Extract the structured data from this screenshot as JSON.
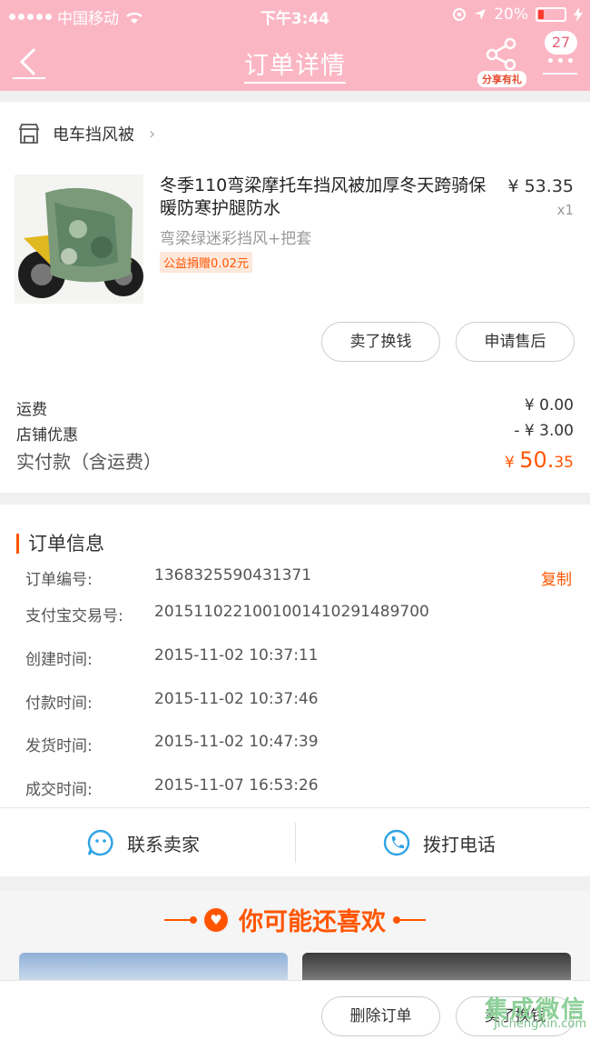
{
  "status_bar": {
    "carrier": "中国移动",
    "time": "下午3:44",
    "battery": "20%"
  },
  "nav": {
    "title": "订单详情",
    "share_tag": "分享有礼",
    "badge_count": "27"
  },
  "shop": {
    "name": "电车挡风被"
  },
  "product": {
    "title": "冬季110弯梁摩托车挡风被加厚冬天跨骑保暖防寒护腿防水",
    "price": "¥ 53.35",
    "qty": "x1",
    "sku": "弯梁绿迷彩挡风+把套",
    "charity_tag": "公益捐赠0.02元",
    "btn_sell": "卖了换钱",
    "btn_aftersale": "申请售后"
  },
  "fees": {
    "shipping_label": "运费",
    "shipping_value": "¥ 0.00",
    "discount_label": "店铺优惠",
    "discount_value": "- ¥ 3.00",
    "total_label": "实付款（含运费）",
    "total_currency": "¥ ",
    "total_int": "50.",
    "total_dec": "35"
  },
  "order_info": {
    "title": "订单信息",
    "copy_label": "复制",
    "rows": [
      {
        "key": "订单编号:",
        "value": "1368325590431371"
      },
      {
        "key": "支付宝交易号:",
        "value": "2015110221001001410291489700"
      },
      {
        "key": "创建时间:",
        "value": "2015-11-02 10:37:11"
      },
      {
        "key": "付款时间:",
        "value": "2015-11-02 10:37:46"
      },
      {
        "key": "发货时间:",
        "value": "2015-11-02 10:47:39"
      },
      {
        "key": "成交时间:",
        "value": "2015-11-07 16:53:26"
      }
    ]
  },
  "contact": {
    "seller": "联系卖家",
    "phone": "拨打电话"
  },
  "recommend": {
    "title": "你可能还喜欢"
  },
  "bottom": {
    "delete": "删除订单",
    "sell": "卖了换钱"
  },
  "watermark": {
    "big": "集成微信",
    "url": "JiChengXin.com"
  },
  "colors": {
    "header_pink": "#fbb6c4",
    "accent_orange": "#ff5500"
  }
}
